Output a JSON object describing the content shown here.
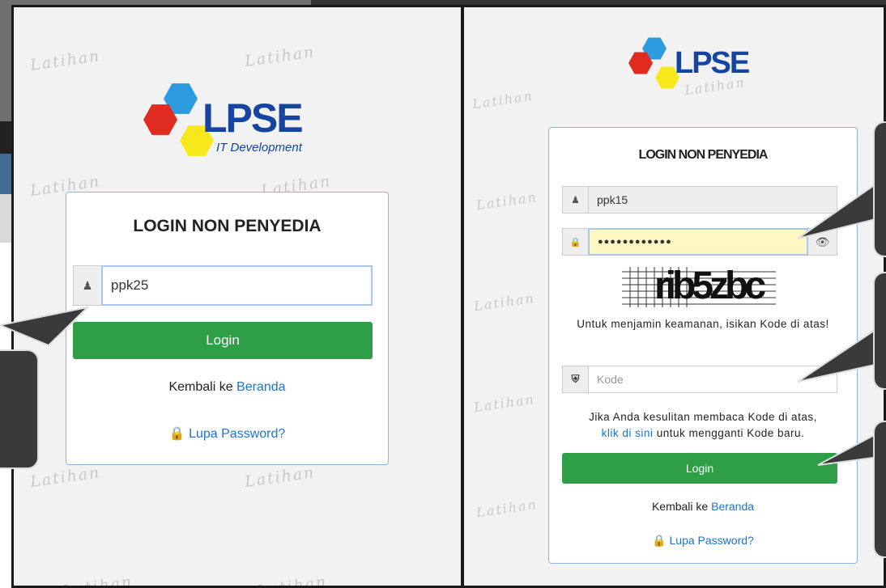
{
  "watermark_text": "Latihan",
  "left": {
    "logo_text": "LPSE",
    "logo_sub": "IT Development",
    "title": "LOGIN NON PENYEDIA",
    "username_value": "ppk25",
    "login_label": "Login",
    "back_prefix": "Kembali ke ",
    "back_link": "Beranda",
    "forgot_label": "Lupa Password?"
  },
  "right": {
    "logo_text": "LPSE",
    "title": "LOGIN NON PENYEDIA",
    "username_value": "ppk15",
    "password_value": "●●●●●●●●●●●●",
    "captcha_text": "rib5zbc",
    "captcha_hint": "Untuk menjamin keamanan, isikan Kode di atas!",
    "kode_placeholder": "Kode",
    "help_line1": "Jika Anda kesulitan membaca Kode di atas,",
    "help_link": "klik di sini",
    "help_line2": " untuk mengganti Kode baru.",
    "login_label": "Login",
    "back_prefix": "Kembali ke ",
    "back_link": "Beranda",
    "forgot_label": "Lupa Password?"
  },
  "colors": {
    "accent_green": "#2e9e47",
    "link_blue": "#1e74c9",
    "logo_blue": "#1545a0",
    "hex_red": "#e02b20",
    "hex_blue": "#2d9be0",
    "hex_yellow": "#f7e81c"
  }
}
